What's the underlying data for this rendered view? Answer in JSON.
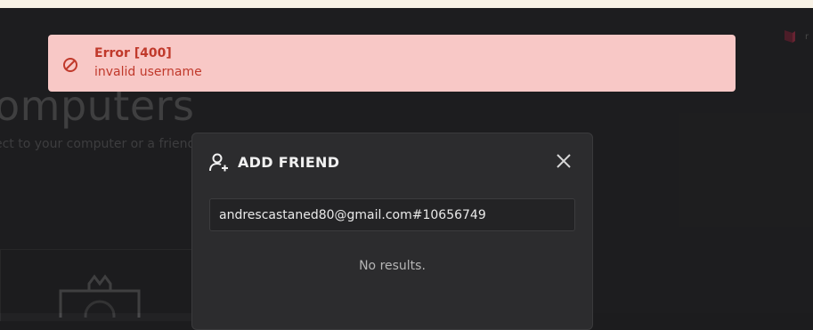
{
  "background": {
    "page_title": "omputers",
    "page_subtitle": "ect to your computer or a friend's"
  },
  "toast": {
    "title": "Error [400]",
    "message": "invalid username",
    "icon": "prohibited-icon",
    "color": "#c0392b",
    "background": "#f8c8c6"
  },
  "modal": {
    "title": "ADD FRIEND",
    "icon": "add-user-icon",
    "close_icon": "close-icon",
    "search_value": "andrescastaned80@gmail.com#10656749",
    "no_results": "No results."
  }
}
